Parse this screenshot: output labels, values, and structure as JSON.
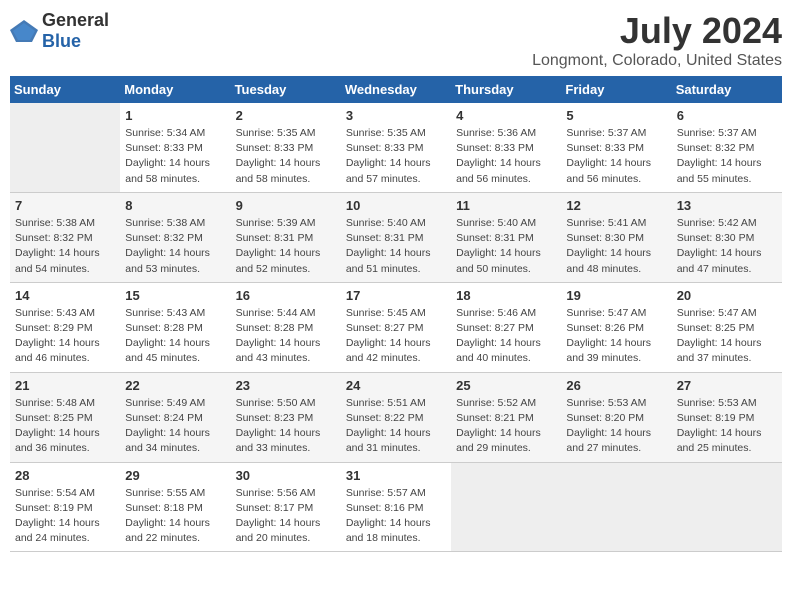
{
  "header": {
    "logo_general": "General",
    "logo_blue": "Blue",
    "title": "July 2024",
    "subtitle": "Longmont, Colorado, United States"
  },
  "calendar": {
    "days_of_week": [
      "Sunday",
      "Monday",
      "Tuesday",
      "Wednesday",
      "Thursday",
      "Friday",
      "Saturday"
    ],
    "weeks": [
      [
        {
          "day": "",
          "sunrise": "",
          "sunset": "",
          "daylight": ""
        },
        {
          "day": "1",
          "sunrise": "Sunrise: 5:34 AM",
          "sunset": "Sunset: 8:33 PM",
          "daylight": "Daylight: 14 hours and 58 minutes."
        },
        {
          "day": "2",
          "sunrise": "Sunrise: 5:35 AM",
          "sunset": "Sunset: 8:33 PM",
          "daylight": "Daylight: 14 hours and 58 minutes."
        },
        {
          "day": "3",
          "sunrise": "Sunrise: 5:35 AM",
          "sunset": "Sunset: 8:33 PM",
          "daylight": "Daylight: 14 hours and 57 minutes."
        },
        {
          "day": "4",
          "sunrise": "Sunrise: 5:36 AM",
          "sunset": "Sunset: 8:33 PM",
          "daylight": "Daylight: 14 hours and 56 minutes."
        },
        {
          "day": "5",
          "sunrise": "Sunrise: 5:37 AM",
          "sunset": "Sunset: 8:33 PM",
          "daylight": "Daylight: 14 hours and 56 minutes."
        },
        {
          "day": "6",
          "sunrise": "Sunrise: 5:37 AM",
          "sunset": "Sunset: 8:32 PM",
          "daylight": "Daylight: 14 hours and 55 minutes."
        }
      ],
      [
        {
          "day": "7",
          "sunrise": "Sunrise: 5:38 AM",
          "sunset": "Sunset: 8:32 PM",
          "daylight": "Daylight: 14 hours and 54 minutes."
        },
        {
          "day": "8",
          "sunrise": "Sunrise: 5:38 AM",
          "sunset": "Sunset: 8:32 PM",
          "daylight": "Daylight: 14 hours and 53 minutes."
        },
        {
          "day": "9",
          "sunrise": "Sunrise: 5:39 AM",
          "sunset": "Sunset: 8:31 PM",
          "daylight": "Daylight: 14 hours and 52 minutes."
        },
        {
          "day": "10",
          "sunrise": "Sunrise: 5:40 AM",
          "sunset": "Sunset: 8:31 PM",
          "daylight": "Daylight: 14 hours and 51 minutes."
        },
        {
          "day": "11",
          "sunrise": "Sunrise: 5:40 AM",
          "sunset": "Sunset: 8:31 PM",
          "daylight": "Daylight: 14 hours and 50 minutes."
        },
        {
          "day": "12",
          "sunrise": "Sunrise: 5:41 AM",
          "sunset": "Sunset: 8:30 PM",
          "daylight": "Daylight: 14 hours and 48 minutes."
        },
        {
          "day": "13",
          "sunrise": "Sunrise: 5:42 AM",
          "sunset": "Sunset: 8:30 PM",
          "daylight": "Daylight: 14 hours and 47 minutes."
        }
      ],
      [
        {
          "day": "14",
          "sunrise": "Sunrise: 5:43 AM",
          "sunset": "Sunset: 8:29 PM",
          "daylight": "Daylight: 14 hours and 46 minutes."
        },
        {
          "day": "15",
          "sunrise": "Sunrise: 5:43 AM",
          "sunset": "Sunset: 8:28 PM",
          "daylight": "Daylight: 14 hours and 45 minutes."
        },
        {
          "day": "16",
          "sunrise": "Sunrise: 5:44 AM",
          "sunset": "Sunset: 8:28 PM",
          "daylight": "Daylight: 14 hours and 43 minutes."
        },
        {
          "day": "17",
          "sunrise": "Sunrise: 5:45 AM",
          "sunset": "Sunset: 8:27 PM",
          "daylight": "Daylight: 14 hours and 42 minutes."
        },
        {
          "day": "18",
          "sunrise": "Sunrise: 5:46 AM",
          "sunset": "Sunset: 8:27 PM",
          "daylight": "Daylight: 14 hours and 40 minutes."
        },
        {
          "day": "19",
          "sunrise": "Sunrise: 5:47 AM",
          "sunset": "Sunset: 8:26 PM",
          "daylight": "Daylight: 14 hours and 39 minutes."
        },
        {
          "day": "20",
          "sunrise": "Sunrise: 5:47 AM",
          "sunset": "Sunset: 8:25 PM",
          "daylight": "Daylight: 14 hours and 37 minutes."
        }
      ],
      [
        {
          "day": "21",
          "sunrise": "Sunrise: 5:48 AM",
          "sunset": "Sunset: 8:25 PM",
          "daylight": "Daylight: 14 hours and 36 minutes."
        },
        {
          "day": "22",
          "sunrise": "Sunrise: 5:49 AM",
          "sunset": "Sunset: 8:24 PM",
          "daylight": "Daylight: 14 hours and 34 minutes."
        },
        {
          "day": "23",
          "sunrise": "Sunrise: 5:50 AM",
          "sunset": "Sunset: 8:23 PM",
          "daylight": "Daylight: 14 hours and 33 minutes."
        },
        {
          "day": "24",
          "sunrise": "Sunrise: 5:51 AM",
          "sunset": "Sunset: 8:22 PM",
          "daylight": "Daylight: 14 hours and 31 minutes."
        },
        {
          "day": "25",
          "sunrise": "Sunrise: 5:52 AM",
          "sunset": "Sunset: 8:21 PM",
          "daylight": "Daylight: 14 hours and 29 minutes."
        },
        {
          "day": "26",
          "sunrise": "Sunrise: 5:53 AM",
          "sunset": "Sunset: 8:20 PM",
          "daylight": "Daylight: 14 hours and 27 minutes."
        },
        {
          "day": "27",
          "sunrise": "Sunrise: 5:53 AM",
          "sunset": "Sunset: 8:19 PM",
          "daylight": "Daylight: 14 hours and 25 minutes."
        }
      ],
      [
        {
          "day": "28",
          "sunrise": "Sunrise: 5:54 AM",
          "sunset": "Sunset: 8:19 PM",
          "daylight": "Daylight: 14 hours and 24 minutes."
        },
        {
          "day": "29",
          "sunrise": "Sunrise: 5:55 AM",
          "sunset": "Sunset: 8:18 PM",
          "daylight": "Daylight: 14 hours and 22 minutes."
        },
        {
          "day": "30",
          "sunrise": "Sunrise: 5:56 AM",
          "sunset": "Sunset: 8:17 PM",
          "daylight": "Daylight: 14 hours and 20 minutes."
        },
        {
          "day": "31",
          "sunrise": "Sunrise: 5:57 AM",
          "sunset": "Sunset: 8:16 PM",
          "daylight": "Daylight: 14 hours and 18 minutes."
        },
        {
          "day": "",
          "sunrise": "",
          "sunset": "",
          "daylight": ""
        },
        {
          "day": "",
          "sunrise": "",
          "sunset": "",
          "daylight": ""
        },
        {
          "day": "",
          "sunrise": "",
          "sunset": "",
          "daylight": ""
        }
      ]
    ]
  }
}
